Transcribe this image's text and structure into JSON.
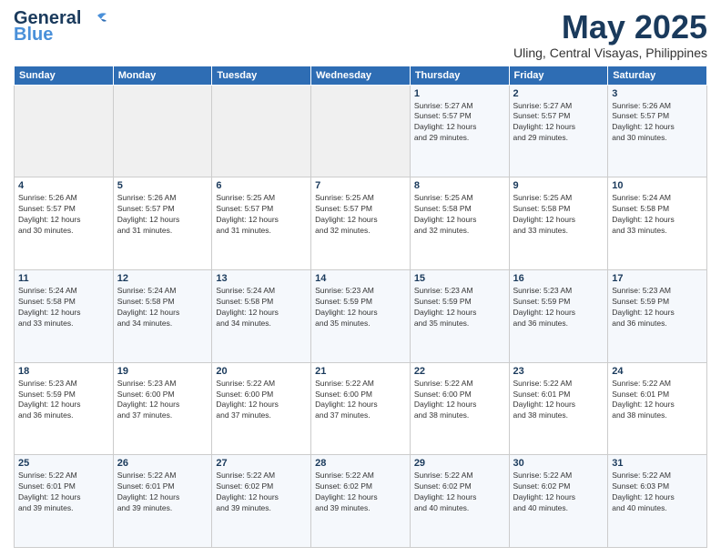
{
  "header": {
    "logo_line1": "General",
    "logo_line2": "Blue",
    "month": "May 2025",
    "location": "Uling, Central Visayas, Philippines"
  },
  "weekdays": [
    "Sunday",
    "Monday",
    "Tuesday",
    "Wednesday",
    "Thursday",
    "Friday",
    "Saturday"
  ],
  "weeks": [
    [
      {
        "day": "",
        "info": ""
      },
      {
        "day": "",
        "info": ""
      },
      {
        "day": "",
        "info": ""
      },
      {
        "day": "",
        "info": ""
      },
      {
        "day": "1",
        "info": "Sunrise: 5:27 AM\nSunset: 5:57 PM\nDaylight: 12 hours\nand 29 minutes."
      },
      {
        "day": "2",
        "info": "Sunrise: 5:27 AM\nSunset: 5:57 PM\nDaylight: 12 hours\nand 29 minutes."
      },
      {
        "day": "3",
        "info": "Sunrise: 5:26 AM\nSunset: 5:57 PM\nDaylight: 12 hours\nand 30 minutes."
      }
    ],
    [
      {
        "day": "4",
        "info": "Sunrise: 5:26 AM\nSunset: 5:57 PM\nDaylight: 12 hours\nand 30 minutes."
      },
      {
        "day": "5",
        "info": "Sunrise: 5:26 AM\nSunset: 5:57 PM\nDaylight: 12 hours\nand 31 minutes."
      },
      {
        "day": "6",
        "info": "Sunrise: 5:25 AM\nSunset: 5:57 PM\nDaylight: 12 hours\nand 31 minutes."
      },
      {
        "day": "7",
        "info": "Sunrise: 5:25 AM\nSunset: 5:57 PM\nDaylight: 12 hours\nand 32 minutes."
      },
      {
        "day": "8",
        "info": "Sunrise: 5:25 AM\nSunset: 5:58 PM\nDaylight: 12 hours\nand 32 minutes."
      },
      {
        "day": "9",
        "info": "Sunrise: 5:25 AM\nSunset: 5:58 PM\nDaylight: 12 hours\nand 33 minutes."
      },
      {
        "day": "10",
        "info": "Sunrise: 5:24 AM\nSunset: 5:58 PM\nDaylight: 12 hours\nand 33 minutes."
      }
    ],
    [
      {
        "day": "11",
        "info": "Sunrise: 5:24 AM\nSunset: 5:58 PM\nDaylight: 12 hours\nand 33 minutes."
      },
      {
        "day": "12",
        "info": "Sunrise: 5:24 AM\nSunset: 5:58 PM\nDaylight: 12 hours\nand 34 minutes."
      },
      {
        "day": "13",
        "info": "Sunrise: 5:24 AM\nSunset: 5:58 PM\nDaylight: 12 hours\nand 34 minutes."
      },
      {
        "day": "14",
        "info": "Sunrise: 5:23 AM\nSunset: 5:59 PM\nDaylight: 12 hours\nand 35 minutes."
      },
      {
        "day": "15",
        "info": "Sunrise: 5:23 AM\nSunset: 5:59 PM\nDaylight: 12 hours\nand 35 minutes."
      },
      {
        "day": "16",
        "info": "Sunrise: 5:23 AM\nSunset: 5:59 PM\nDaylight: 12 hours\nand 36 minutes."
      },
      {
        "day": "17",
        "info": "Sunrise: 5:23 AM\nSunset: 5:59 PM\nDaylight: 12 hours\nand 36 minutes."
      }
    ],
    [
      {
        "day": "18",
        "info": "Sunrise: 5:23 AM\nSunset: 5:59 PM\nDaylight: 12 hours\nand 36 minutes."
      },
      {
        "day": "19",
        "info": "Sunrise: 5:23 AM\nSunset: 6:00 PM\nDaylight: 12 hours\nand 37 minutes."
      },
      {
        "day": "20",
        "info": "Sunrise: 5:22 AM\nSunset: 6:00 PM\nDaylight: 12 hours\nand 37 minutes."
      },
      {
        "day": "21",
        "info": "Sunrise: 5:22 AM\nSunset: 6:00 PM\nDaylight: 12 hours\nand 37 minutes."
      },
      {
        "day": "22",
        "info": "Sunrise: 5:22 AM\nSunset: 6:00 PM\nDaylight: 12 hours\nand 38 minutes."
      },
      {
        "day": "23",
        "info": "Sunrise: 5:22 AM\nSunset: 6:01 PM\nDaylight: 12 hours\nand 38 minutes."
      },
      {
        "day": "24",
        "info": "Sunrise: 5:22 AM\nSunset: 6:01 PM\nDaylight: 12 hours\nand 38 minutes."
      }
    ],
    [
      {
        "day": "25",
        "info": "Sunrise: 5:22 AM\nSunset: 6:01 PM\nDaylight: 12 hours\nand 39 minutes."
      },
      {
        "day": "26",
        "info": "Sunrise: 5:22 AM\nSunset: 6:01 PM\nDaylight: 12 hours\nand 39 minutes."
      },
      {
        "day": "27",
        "info": "Sunrise: 5:22 AM\nSunset: 6:02 PM\nDaylight: 12 hours\nand 39 minutes."
      },
      {
        "day": "28",
        "info": "Sunrise: 5:22 AM\nSunset: 6:02 PM\nDaylight: 12 hours\nand 39 minutes."
      },
      {
        "day": "29",
        "info": "Sunrise: 5:22 AM\nSunset: 6:02 PM\nDaylight: 12 hours\nand 40 minutes."
      },
      {
        "day": "30",
        "info": "Sunrise: 5:22 AM\nSunset: 6:02 PM\nDaylight: 12 hours\nand 40 minutes."
      },
      {
        "day": "31",
        "info": "Sunrise: 5:22 AM\nSunset: 6:03 PM\nDaylight: 12 hours\nand 40 minutes."
      }
    ]
  ]
}
